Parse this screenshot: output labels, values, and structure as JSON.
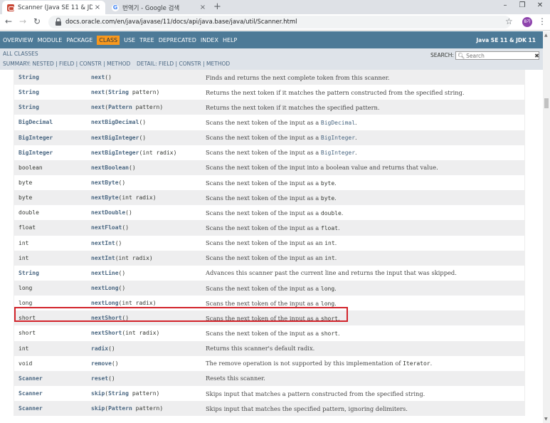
{
  "browser": {
    "tabs": [
      {
        "title": "Scanner (Java SE 11 & JDK 11 )",
        "active": true,
        "close": "×"
      },
      {
        "title": "번역기 - Google 검색",
        "active": false,
        "close": "×"
      }
    ],
    "google_favicon": "G",
    "new_tab": "+",
    "window": {
      "minimize": "–",
      "restore": "❐",
      "close": "✕"
    },
    "nav": {
      "back": "←",
      "forward": "→",
      "reload": "↻"
    },
    "url": "docs.oracle.com/en/java/javase/11/docs/api/java.base/java/util/Scanner.html",
    "star": "☆",
    "profile_initials": "8가",
    "menu": "⋮"
  },
  "javadoc_nav": {
    "items": [
      "OVERVIEW",
      "MODULE",
      "PACKAGE",
      "CLASS",
      "USE",
      "TREE",
      "DEPRECATED",
      "INDEX",
      "HELP"
    ],
    "current": "CLASS",
    "about_language": "Java SE 11 & JDK 11"
  },
  "subnav": {
    "all_classes": "ALL CLASSES",
    "summary": "SUMMARY: NESTED | FIELD | CONSTR | METHOD",
    "detail": "DETAIL: FIELD | CONSTR | METHOD",
    "search_label": "SEARCH:",
    "search_placeholder": "Search",
    "search_icon": "magnifier-icon",
    "reset_icon": "✖"
  },
  "accent_colors": {
    "nav_bg": "#4d7a97",
    "current_tab": "#f8981d",
    "highlight_border": "#d2232a"
  },
  "methods": [
    {
      "type": "String",
      "type_link": true,
      "name": "next",
      "params": [],
      "desc": [
        {
          "t": "Finds and returns the next complete token from this scanner."
        }
      ]
    },
    {
      "type": "String",
      "type_link": true,
      "name": "next",
      "params": [
        {
          "t": "String",
          "link": true
        },
        {
          "t": " pattern"
        }
      ],
      "desc": [
        {
          "t": "Returns the next token if it matches the pattern constructed from the specified string."
        }
      ]
    },
    {
      "type": "String",
      "type_link": true,
      "name": "next",
      "params": [
        {
          "t": "Pattern",
          "link": true
        },
        {
          "t": " pattern"
        }
      ],
      "desc": [
        {
          "t": "Returns the next token if it matches the specified pattern."
        }
      ]
    },
    {
      "type": "BigDecimal",
      "type_link": true,
      "name": "nextBigDecimal",
      "params": [],
      "desc": [
        {
          "t": "Scans the next token of the input as a "
        },
        {
          "t": "BigDecimal",
          "code": true,
          "link": true
        },
        {
          "t": "."
        }
      ]
    },
    {
      "type": "BigInteger",
      "type_link": true,
      "name": "nextBigInteger",
      "params": [],
      "desc": [
        {
          "t": "Scans the next token of the input as a "
        },
        {
          "t": "BigInteger",
          "code": true,
          "link": true
        },
        {
          "t": "."
        }
      ]
    },
    {
      "type": "BigInteger",
      "type_link": true,
      "name": "nextBigInteger",
      "params": [
        {
          "t": "int radix"
        }
      ],
      "desc": [
        {
          "t": "Scans the next token of the input as a "
        },
        {
          "t": "BigInteger",
          "code": true,
          "link": true
        },
        {
          "t": "."
        }
      ]
    },
    {
      "type": "boolean",
      "type_link": false,
      "name": "nextBoolean",
      "params": [],
      "desc": [
        {
          "t": "Scans the next token of the input into a boolean value and returns that value."
        }
      ]
    },
    {
      "type": "byte",
      "type_link": false,
      "name": "nextByte",
      "params": [],
      "desc": [
        {
          "t": "Scans the next token of the input as a "
        },
        {
          "t": "byte",
          "code": true
        },
        {
          "t": "."
        }
      ]
    },
    {
      "type": "byte",
      "type_link": false,
      "name": "nextByte",
      "params": [
        {
          "t": "int radix"
        }
      ],
      "desc": [
        {
          "t": "Scans the next token of the input as a "
        },
        {
          "t": "byte",
          "code": true
        },
        {
          "t": "."
        }
      ]
    },
    {
      "type": "double",
      "type_link": false,
      "name": "nextDouble",
      "params": [],
      "desc": [
        {
          "t": "Scans the next token of the input as a "
        },
        {
          "t": "double",
          "code": true
        },
        {
          "t": "."
        }
      ]
    },
    {
      "type": "float",
      "type_link": false,
      "name": "nextFloat",
      "params": [],
      "desc": [
        {
          "t": "Scans the next token of the input as a "
        },
        {
          "t": "float",
          "code": true
        },
        {
          "t": "."
        }
      ]
    },
    {
      "type": "int",
      "type_link": false,
      "name": "nextInt",
      "params": [],
      "desc": [
        {
          "t": "Scans the next token of the input as an "
        },
        {
          "t": "int",
          "code": true
        },
        {
          "t": "."
        }
      ],
      "highlighted": true
    },
    {
      "type": "int",
      "type_link": false,
      "name": "nextInt",
      "params": [
        {
          "t": "int radix"
        }
      ],
      "desc": [
        {
          "t": "Scans the next token of the input as an "
        },
        {
          "t": "int",
          "code": true
        },
        {
          "t": "."
        }
      ]
    },
    {
      "type": "String",
      "type_link": true,
      "name": "nextLine",
      "params": [],
      "desc": [
        {
          "t": "Advances this scanner past the current line and returns the input that was skipped."
        }
      ]
    },
    {
      "type": "long",
      "type_link": false,
      "name": "nextLong",
      "params": [],
      "desc": [
        {
          "t": "Scans the next token of the input as a "
        },
        {
          "t": "long",
          "code": true
        },
        {
          "t": "."
        }
      ]
    },
    {
      "type": "long",
      "type_link": false,
      "name": "nextLong",
      "params": [
        {
          "t": "int radix"
        }
      ],
      "desc": [
        {
          "t": "Scans the next token of the input as a "
        },
        {
          "t": "long",
          "code": true
        },
        {
          "t": "."
        }
      ]
    },
    {
      "type": "short",
      "type_link": false,
      "name": "nextShort",
      "params": [],
      "desc": [
        {
          "t": "Scans the next token of the input as a "
        },
        {
          "t": "short",
          "code": true
        },
        {
          "t": "."
        }
      ]
    },
    {
      "type": "short",
      "type_link": false,
      "name": "nextShort",
      "params": [
        {
          "t": "int radix"
        }
      ],
      "desc": [
        {
          "t": "Scans the next token of the input as a "
        },
        {
          "t": "short",
          "code": true
        },
        {
          "t": "."
        }
      ]
    },
    {
      "type": "int",
      "type_link": false,
      "name": "radix",
      "params": [],
      "desc": [
        {
          "t": "Returns this scanner's default radix."
        }
      ]
    },
    {
      "type": "void",
      "type_link": false,
      "name": "remove",
      "params": [],
      "desc": [
        {
          "t": "The remove operation is not supported by this implementation of "
        },
        {
          "t": "Iterator",
          "code": true
        },
        {
          "t": "."
        }
      ]
    },
    {
      "type": "Scanner",
      "type_link": true,
      "name": "reset",
      "params": [],
      "desc": [
        {
          "t": "Resets this scanner."
        }
      ]
    },
    {
      "type": "Scanner",
      "type_link": true,
      "name": "skip",
      "params": [
        {
          "t": "String",
          "link": true
        },
        {
          "t": " pattern"
        }
      ],
      "desc": [
        {
          "t": "Skips input that matches a pattern constructed from the specified string."
        }
      ]
    },
    {
      "type": "Scanner",
      "type_link": true,
      "name": "skip",
      "params": [
        {
          "t": "Pattern",
          "link": true
        },
        {
          "t": " pattern"
        }
      ],
      "desc": [
        {
          "t": "Skips input that matches the specified pattern, ignoring delimiters."
        }
      ]
    }
  ]
}
